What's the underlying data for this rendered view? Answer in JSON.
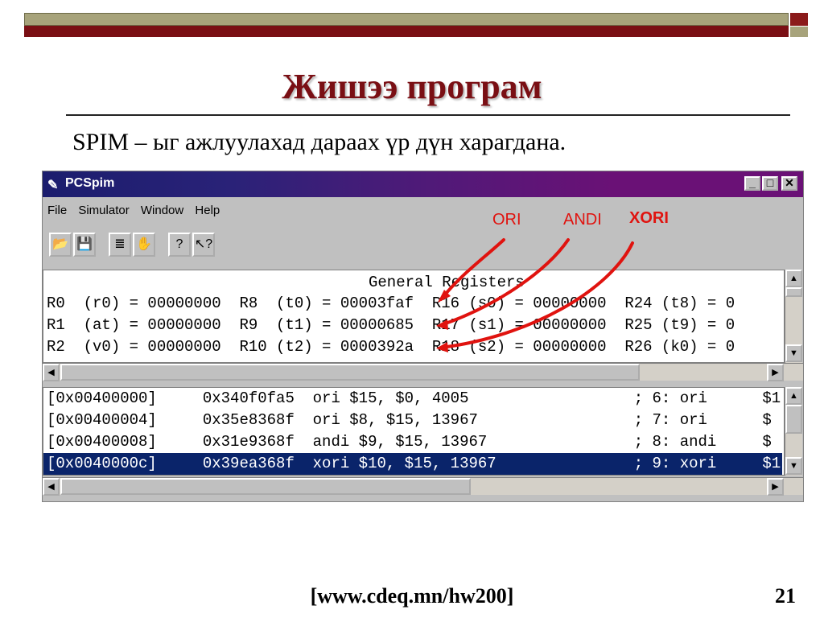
{
  "slide": {
    "title": "Жишээ програм",
    "subtitle": "SPIM – ыг ажлуулахад дараах үр дүн харагдана.",
    "footer_url": "[www.cdeq.mn/hw200]",
    "page_number": "21"
  },
  "window": {
    "title": "PCSpim",
    "minimize_label": "_",
    "maximize_label": "□",
    "close_label": "✕"
  },
  "menu": {
    "file": "File",
    "simulator": "Simulator",
    "window": "Window",
    "help": "Help"
  },
  "toolbar": {
    "open_icon": "📂",
    "save_icon": "💾",
    "list_icon": "≣",
    "stop_icon": "✋",
    "help_icon": "?",
    "context_help_icon": "↖?"
  },
  "registers": {
    "header": "General Registers",
    "rows": [
      "R0  (r0) = 00000000  R8  (t0) = 00003faf  R16 (s0) = 00000000  R24 (t8) = 0",
      "R1  (at) = 00000000  R9  (t1) = 00000685  R17 (s1) = 00000000  R25 (t9) = 0",
      "R2  (v0) = 00000000  R10 (t2) = 0000392a  R18 (s2) = 00000000  R26 (k0) = 0"
    ]
  },
  "text_segment": {
    "rows": [
      "[0x00400000]     0x340f0fa5  ori $15, $0, 4005                  ; 6: ori      $1",
      "[0x00400004]     0x35e8368f  ori $8, $15, 13967                 ; 7: ori      $",
      "[0x00400008]     0x31e9368f  andi $9, $15, 13967                ; 8: andi     $",
      "[0x0040000c]     0x39ea368f  xori $10, $15, 13967               ; 9: xori     $1"
    ],
    "selected_index": 3
  },
  "annotations": {
    "ori": "ORI",
    "andi": "ANDI",
    "xori": "XORI"
  },
  "colors": {
    "title": "#7a0f14",
    "annotation": "#e0130f",
    "selection": "#0a246a"
  }
}
